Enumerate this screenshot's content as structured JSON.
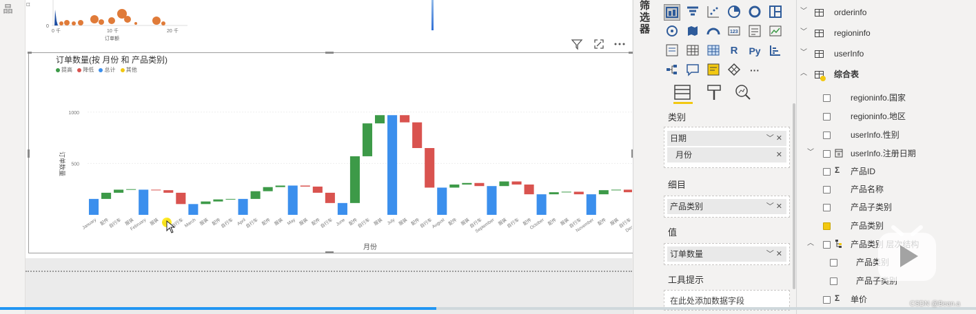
{
  "left_strip": {
    "glyph": "晶"
  },
  "scatter": {
    "y_tick": "0",
    "x_ticks": [
      "0 千",
      "10 千",
      "20 千"
    ],
    "xlabel": "订单额",
    "ylabel_partial": "ロ"
  },
  "visual": {
    "title": "订单数量(按 月份 和 产品类别)",
    "legend": [
      {
        "label": "提高",
        "color": "#3d9a48"
      },
      {
        "label": "降低",
        "color": "#d9534f"
      },
      {
        "label": "总计",
        "color": "#3b8fed"
      },
      {
        "label": "其他",
        "color": "#f2c811"
      }
    ],
    "xlabel": "月份",
    "ylabel": "订单数量"
  },
  "chart_data": {
    "type": "bar",
    "subtype": "waterfall",
    "title": "订单数量(按 月份 和 产品类别)",
    "xlabel": "月份",
    "ylabel": "订单数量",
    "ylim": [
      0,
      1300
    ],
    "y_ticks": [
      "500",
      "1000"
    ],
    "gridlines": true,
    "legend_position": "top-left",
    "categories": [
      "January",
      "配件",
      "自行车",
      "服装",
      "February",
      "服装",
      "配件",
      "自行车",
      "March",
      "服装",
      "配件",
      "自行车",
      "April",
      "自行车",
      "配件",
      "服装",
      "May",
      "服装",
      "配件",
      "自行车",
      "June",
      "配件",
      "自行车",
      "服装",
      "July",
      "服装",
      "配件",
      "自行车",
      "August",
      "配件",
      "服装",
      "自行车",
      "September",
      "服装",
      "自行车",
      "配件",
      "October",
      "配件",
      "服装",
      "自行车",
      "November",
      "配件",
      "服装",
      "自行车",
      "December"
    ],
    "bars": [
      {
        "kind": "total",
        "from": 0,
        "to": 155
      },
      {
        "kind": "increase",
        "from": 155,
        "to": 215
      },
      {
        "kind": "increase",
        "from": 215,
        "to": 245
      },
      {
        "kind": "increase",
        "from": 245,
        "to": 250
      },
      {
        "kind": "total",
        "from": 0,
        "to": 245
      },
      {
        "kind": "decrease",
        "from": 245,
        "to": 240
      },
      {
        "kind": "decrease",
        "from": 240,
        "to": 215
      },
      {
        "kind": "decrease",
        "from": 215,
        "to": 105
      },
      {
        "kind": "total",
        "from": 0,
        "to": 105
      },
      {
        "kind": "increase",
        "from": 105,
        "to": 130
      },
      {
        "kind": "increase",
        "from": 130,
        "to": 150
      },
      {
        "kind": "increase",
        "from": 150,
        "to": 155
      },
      {
        "kind": "total",
        "from": 0,
        "to": 155
      },
      {
        "kind": "increase",
        "from": 155,
        "to": 230
      },
      {
        "kind": "increase",
        "from": 230,
        "to": 270
      },
      {
        "kind": "increase",
        "from": 270,
        "to": 285
      },
      {
        "kind": "total",
        "from": 0,
        "to": 285
      },
      {
        "kind": "decrease",
        "from": 285,
        "to": 275
      },
      {
        "kind": "decrease",
        "from": 275,
        "to": 215
      },
      {
        "kind": "decrease",
        "from": 215,
        "to": 115
      },
      {
        "kind": "total",
        "from": 0,
        "to": 115
      },
      {
        "kind": "increase",
        "from": 115,
        "to": 570
      },
      {
        "kind": "increase",
        "from": 570,
        "to": 890
      },
      {
        "kind": "increase",
        "from": 890,
        "to": 970
      },
      {
        "kind": "total",
        "from": 0,
        "to": 970
      },
      {
        "kind": "decrease",
        "from": 970,
        "to": 900
      },
      {
        "kind": "decrease",
        "from": 900,
        "to": 650
      },
      {
        "kind": "decrease",
        "from": 650,
        "to": 265
      },
      {
        "kind": "total",
        "from": 0,
        "to": 265
      },
      {
        "kind": "increase",
        "from": 265,
        "to": 295
      },
      {
        "kind": "increase",
        "from": 295,
        "to": 310
      },
      {
        "kind": "decrease",
        "from": 310,
        "to": 280
      },
      {
        "kind": "total",
        "from": 0,
        "to": 280
      },
      {
        "kind": "increase",
        "from": 280,
        "to": 325
      },
      {
        "kind": "decrease",
        "from": 325,
        "to": 295
      },
      {
        "kind": "decrease",
        "from": 295,
        "to": 200
      },
      {
        "kind": "total",
        "from": 0,
        "to": 200
      },
      {
        "kind": "increase",
        "from": 200,
        "to": 220
      },
      {
        "kind": "increase",
        "from": 220,
        "to": 225
      },
      {
        "kind": "decrease",
        "from": 225,
        "to": 200
      },
      {
        "kind": "total",
        "from": 0,
        "to": 200
      },
      {
        "kind": "increase",
        "from": 200,
        "to": 240
      },
      {
        "kind": "increase",
        "from": 240,
        "to": 245
      },
      {
        "kind": "decrease",
        "from": 245,
        "to": 220
      },
      {
        "kind": "total",
        "from": 0,
        "to": 220
      }
    ]
  },
  "filters_label": "筛选器",
  "viz_pane": {
    "icons": [
      "matrix-visual",
      "funnel-visual",
      "scatter-visual",
      "pie-visual",
      "donut-visual",
      "treemap-visual",
      "map-visual",
      "filled-map-visual",
      "gauge-visual",
      "card-visual",
      "multirow-card-visual",
      "kpi-visual",
      "slicer-visual",
      "table-visual",
      "matrix-table-visual",
      "r-visual",
      "python-visual",
      "key-influencers-visual",
      "decomposition-tree-visual",
      "qa-visual",
      "smart-narrative-visual",
      "arcgis-visual",
      "more-visuals"
    ],
    "r_label": "R",
    "py_label": "Py",
    "more_label": "···",
    "wells": {
      "category_label": "类别",
      "category_fields": [
        {
          "name": "日期"
        },
        {
          "name": "月份"
        }
      ],
      "breakdown_label": "细目",
      "breakdown_field": "产品类别",
      "values_label": "值",
      "values_field": "订单数量",
      "tooltips_label": "工具提示",
      "tooltips_placeholder": "在此处添加数据字段"
    }
  },
  "fields_pane": {
    "tables": [
      {
        "name": "orderinfo",
        "expanded": false
      },
      {
        "name": "regioninfo",
        "expanded": false
      },
      {
        "name": "userInfo",
        "expanded": false
      },
      {
        "name": "综合表",
        "expanded": true
      }
    ],
    "fields": [
      {
        "name": "regioninfo.国家",
        "checked": false,
        "sigma": false
      },
      {
        "name": "regioninfo.地区",
        "checked": false,
        "sigma": false
      },
      {
        "name": "userInfo.性别",
        "checked": false,
        "sigma": false
      },
      {
        "name": "userInfo.注册日期",
        "checked": false,
        "sigma": false,
        "date": true
      },
      {
        "name": "产品ID",
        "checked": false,
        "sigma": true
      },
      {
        "name": "产品名称",
        "checked": false,
        "sigma": false
      },
      {
        "name": "产品子类别",
        "checked": false,
        "sigma": false
      },
      {
        "name": "产品类别",
        "checked": true,
        "sigma": false
      },
      {
        "name": "产品类别 层次结构",
        "checked": false,
        "sigma": false,
        "hierarchy": true
      },
      {
        "name": "产品类别",
        "checked": false,
        "sigma": false,
        "child": true
      },
      {
        "name": "产品子类别",
        "checked": false,
        "sigma": false,
        "child": true
      },
      {
        "name": "单价",
        "checked": false,
        "sigma": true
      }
    ]
  },
  "progress": {
    "fraction": 0.447
  },
  "watermark": "CSDN @Bean.a"
}
